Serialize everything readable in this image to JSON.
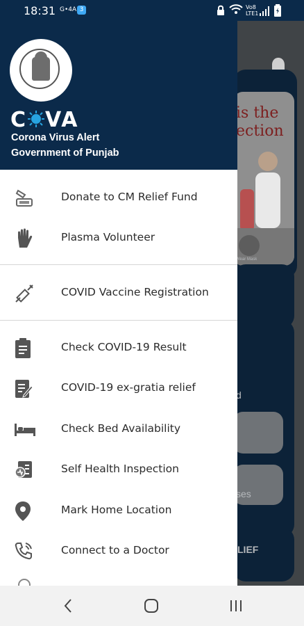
{
  "status_bar": {
    "time": "18:31",
    "carrier_small": "G•4A",
    "badge": "3",
    "right_icons": [
      "lock-icon",
      "wifi-icon",
      "volte-icon",
      "signal-icon",
      "battery-icon"
    ],
    "volte_label": "Vo8 LTE1"
  },
  "drawer": {
    "app_name_prefix": "C",
    "app_name_suffix": "VA",
    "subtitle_line1": "Corona Virus Alert",
    "subtitle_line2": "Government of Punjab",
    "items": [
      {
        "label": "Donate to CM Relief Fund",
        "icon": "donate-icon"
      },
      {
        "label": "Plasma Volunteer",
        "icon": "hand-icon"
      },
      {
        "label": "COVID Vaccine Registration",
        "icon": "syringe-icon"
      },
      {
        "label": "Check COVID-19 Result",
        "icon": "clipboard-icon"
      },
      {
        "label": "COVID-19 ex-gratia relief",
        "icon": "document-edit-icon"
      },
      {
        "label": "Check Bed Availability",
        "icon": "bed-icon"
      },
      {
        "label": "Self Health Inspection",
        "icon": "health-report-icon"
      },
      {
        "label": "Mark Home Location",
        "icon": "location-pin-icon"
      },
      {
        "label": "Connect to a Doctor",
        "icon": "phone-icon"
      }
    ]
  },
  "background": {
    "banner_text": "is the ection",
    "wear_mask_label": "Wear Mask",
    "label_d": "d",
    "label_ses": "ses",
    "label_lief": "LIEF"
  },
  "colors": {
    "header_bg": "#0b2a4a",
    "accent": "#27a3e0",
    "text": "#2b2b2b"
  }
}
